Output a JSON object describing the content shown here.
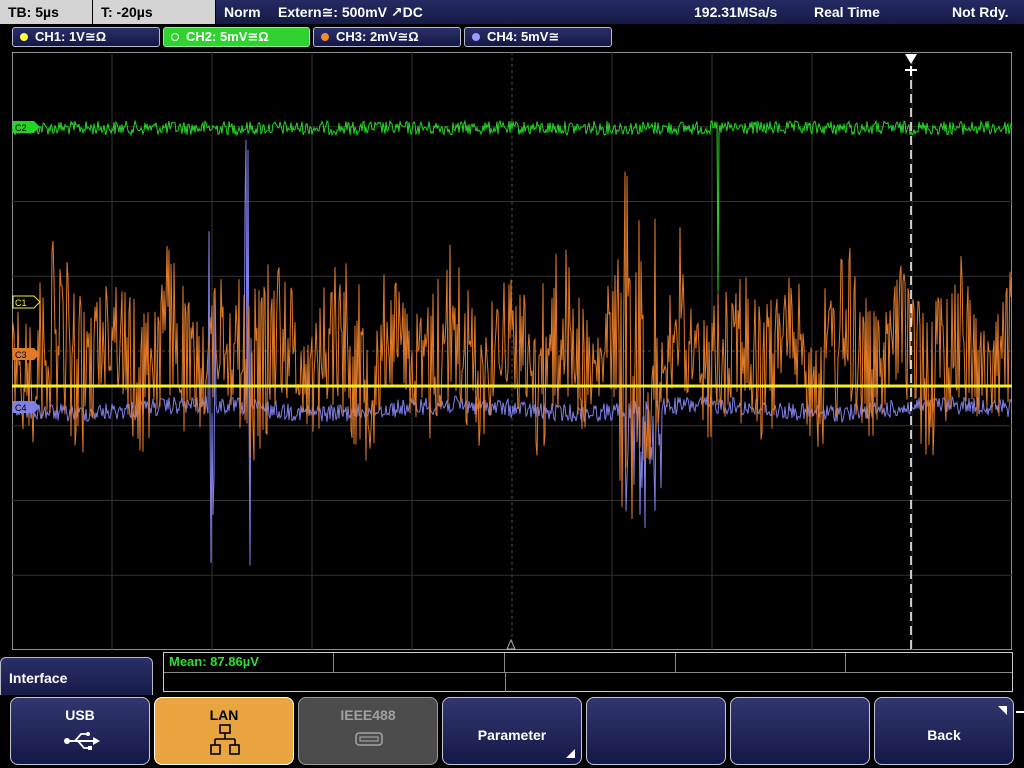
{
  "topbar": {
    "timebase": "TB: 5µs",
    "trigger_time": "T: -20µs",
    "mode": "Norm",
    "trigger_source": "Extern≅: 500mV ↗DC",
    "sample_rate": "192.31MSa/s",
    "acq_mode": "Real Time",
    "state": "Not Rdy."
  },
  "channels": [
    {
      "label": "CH1: 1V≅Ω",
      "color": "#ffff40",
      "active": false
    },
    {
      "label": "CH2: 5mV≅Ω",
      "color": "#2fd22f",
      "active": true
    },
    {
      "label": "CH3: 2mV≅Ω",
      "color": "#f08a30",
      "active": false
    },
    {
      "label": "CH4: 5mV≅",
      "color": "#9a9aff",
      "active": false
    }
  ],
  "markers": {
    "c1": "C1",
    "c2": "C2",
    "c3": "C3",
    "c4": "C4"
  },
  "colors": {
    "ch1": "#f2ef2a",
    "ch2": "#24d424",
    "ch3": "#e07a28",
    "ch4": "#7f7fe6"
  },
  "measurement": {
    "mean": "Mean: 87.86µV"
  },
  "menu": {
    "title": "Interface",
    "softkeys": [
      {
        "label": "USB",
        "icon": "usb-icon",
        "state": "normal"
      },
      {
        "label": "LAN",
        "icon": "lan-icon",
        "state": "active"
      },
      {
        "label": "IEEE488",
        "icon": "gpib-connector-icon",
        "state": "disabled"
      },
      {
        "label": "Parameter",
        "icon": "",
        "state": "normal"
      },
      {
        "label": "",
        "icon": "",
        "state": "normal"
      },
      {
        "label": "",
        "icon": "",
        "state": "normal"
      },
      {
        "label": "Back",
        "icon": "",
        "state": "normal"
      }
    ]
  }
}
